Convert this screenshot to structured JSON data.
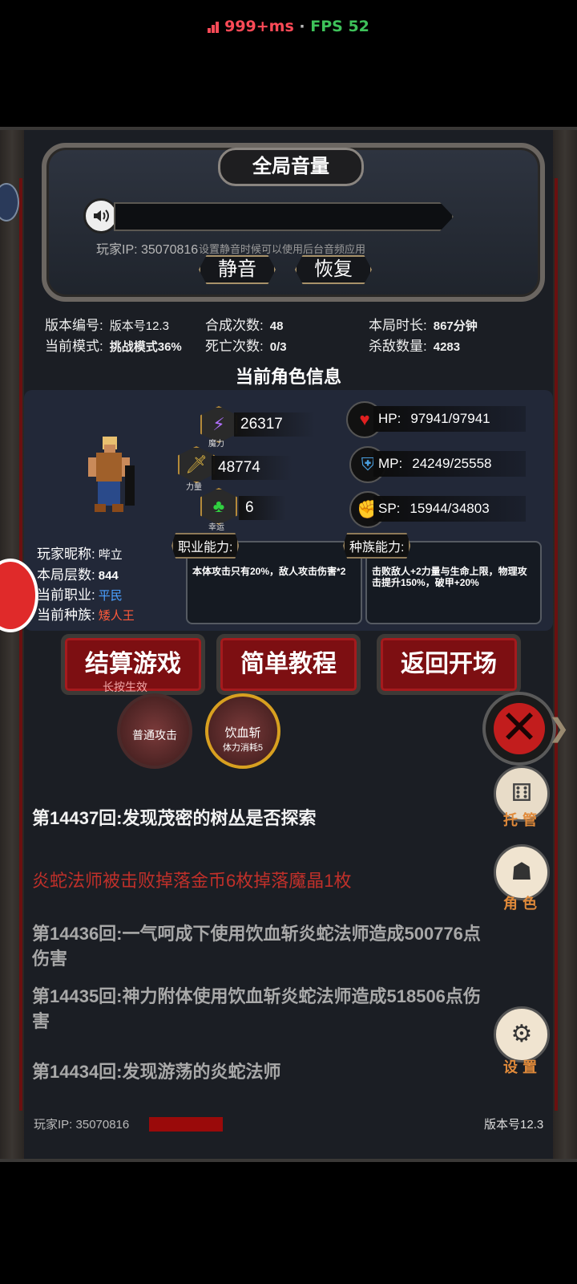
{
  "status": {
    "ping": "999+ms",
    "separator": "·",
    "fps": "FPS 52",
    "ping_color": "#ff4a57",
    "fps_color": "#3ec25a"
  },
  "volume": {
    "title": "全局音量",
    "player_ip": "玩家IP: 35070816",
    "hint": "设置静音时候可以使用后台音频应用",
    "mute_label": "静音",
    "restore_label": "恢复"
  },
  "stats": {
    "version_label": "版本编号:",
    "version_value": "版本号12.3",
    "mode_label": "当前模式:",
    "mode_value": "挑战模式36%",
    "craft_label": "合成次数:",
    "craft_value": "48",
    "death_label": "死亡次数:",
    "death_value": "0/3",
    "time_label": "本局时长:",
    "time_value": "867分钟",
    "kills_label": "杀敌数量:",
    "kills_value": "4283"
  },
  "role": {
    "title": "当前角色信息",
    "magic": {
      "label": "魔力",
      "value": "26317",
      "icon": "lightning-icon"
    },
    "strength": {
      "label": "力量",
      "value": "48774",
      "icon": "sword-icon"
    },
    "luck": {
      "label": "幸运",
      "value": "6",
      "icon": "clover-icon"
    },
    "hp": {
      "label": "HP:",
      "value": "97941/97941",
      "icon": "heart-icon"
    },
    "mp": {
      "label": "MP:",
      "value": "24249/25558",
      "icon": "armor-icon"
    },
    "sp": {
      "label": "SP:",
      "value": "15944/34803",
      "icon": "muscle-icon"
    },
    "nickname_label": "玩家昵称:",
    "nickname": "哔立",
    "floor_label": "本局层数:",
    "floor": "844",
    "job_label": "当前职业:",
    "job": "平民",
    "job_color": "#4aa0ff",
    "race_label": "当前种族:",
    "race": "矮人王",
    "race_color": "#ff5a3a",
    "job_ability_label": "职业能力:",
    "job_ability_text": "本体攻击只有20%，敌人攻击伤害*2",
    "race_ability_label": "种族能力:",
    "race_ability_text": "击败敌人+2力量与生命上限，物理攻击提升150%，破甲+20%"
  },
  "buttons": {
    "settle": "结算游戏",
    "settle_hint": "长按生效",
    "tutorial": "简单教程",
    "back": "返回开场"
  },
  "skills": [
    {
      "name": "普通攻击",
      "sub": ""
    },
    {
      "name": "饮血斩",
      "sub": "体力消耗5"
    }
  ],
  "log": [
    {
      "text": "第14437回:发现茂密的树丛是否探索",
      "color": "#f2f2f2"
    },
    {
      "text": "炎蛇法师被击败掉落金币6枚掉落魔晶1枚",
      "color": "#c0302a"
    },
    {
      "text": "第14436回:一气呵成下使用饮血斩炎蛇法师造成500776点伤害",
      "color": "#a8a8a8"
    },
    {
      "text": "第14435回:神力附体使用饮血斩炎蛇法师造成518506点伤害",
      "color": "#a8a8a8"
    },
    {
      "text": "第14434回:发现游荡的炎蛇法师",
      "color": "#a8a8a8"
    }
  ],
  "side_menu": {
    "auto": "托管",
    "role": "角色",
    "settings": "设置"
  },
  "footer": {
    "player_ip": "玩家IP: 35070816",
    "version": "版本号12.3"
  }
}
